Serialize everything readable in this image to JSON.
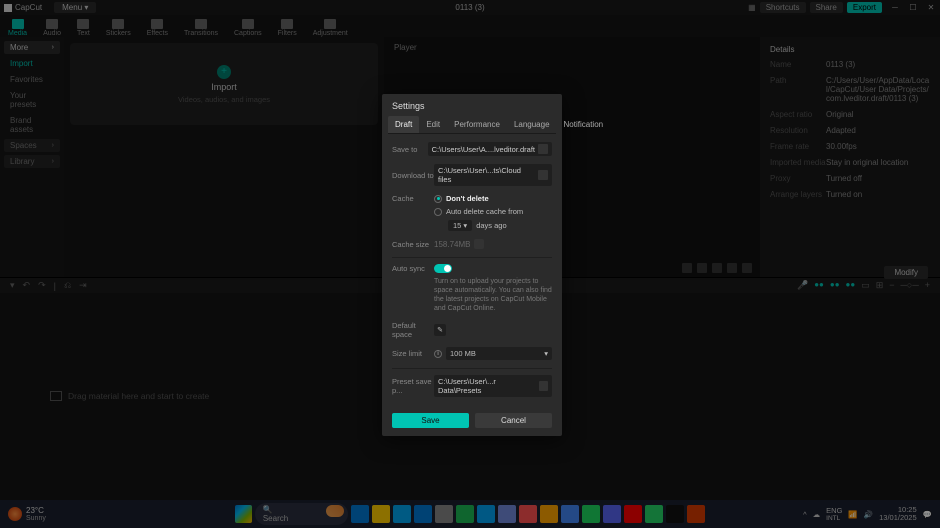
{
  "titlebar": {
    "app_name": "CapCut",
    "menu": "Menu",
    "project": "0113 (3)",
    "shortcuts": "Shortcuts",
    "share": "Share",
    "export": "Export"
  },
  "toolbar": {
    "tabs": [
      "Media",
      "Audio",
      "Text",
      "Stickers",
      "Effects",
      "Transitions",
      "Captions",
      "Filters",
      "Adjustment"
    ]
  },
  "sidebar": {
    "items": [
      {
        "label": "More",
        "type": "drop"
      },
      {
        "label": "Import",
        "type": "imp"
      },
      {
        "label": "Favorites",
        "type": "item"
      },
      {
        "label": "Your presets",
        "type": "item"
      },
      {
        "label": "Brand assets",
        "type": "item"
      },
      {
        "label": "Spaces",
        "type": "drop"
      },
      {
        "label": "Library",
        "type": "drop"
      }
    ]
  },
  "importbox": {
    "title": "Import",
    "subtitle": "Videos, audios, and images"
  },
  "player": {
    "title": "Player"
  },
  "details": {
    "header": "Details",
    "rows": [
      {
        "k": "Name",
        "v": "0113 (3)"
      },
      {
        "k": "Path",
        "v": "C:/Users/User/AppData/Local/CapCut/User Data/Projects/com.lveditor.draft/0113 (3)"
      },
      {
        "k": "Aspect ratio",
        "v": "Original"
      },
      {
        "k": "Resolution",
        "v": "Adapted"
      },
      {
        "k": "Frame rate",
        "v": "30.00fps"
      },
      {
        "k": "Imported media",
        "v": "Stay in original location"
      },
      {
        "k": "Proxy",
        "v": "Turned off"
      },
      {
        "k": "Arrange layers",
        "v": "Turned on"
      }
    ],
    "modify": "Modify"
  },
  "timeline": {
    "hint": "Drag material here and start to create"
  },
  "modal": {
    "title": "Settings",
    "tabs": [
      "Draft",
      "Edit",
      "Performance",
      "Language",
      "Notification"
    ],
    "save_to": {
      "label": "Save to",
      "path": "C:\\Users\\User\\A....lveditor.draft"
    },
    "download_to": {
      "label": "Download to",
      "path": "C:\\Users\\User\\...ts\\Cloud files"
    },
    "cache": {
      "label": "Cache",
      "dont_delete": "Don't delete",
      "auto_delete": "Auto delete cache from",
      "days_value": "15",
      "days_suffix": "days ago"
    },
    "cache_size": {
      "label": "Cache size",
      "value": "158.74MB"
    },
    "auto_sync": {
      "label": "Auto sync",
      "desc": "Turn on to upload your projects to space automatically. You can also find the latest projects on CapCut Mobile and CapCut Online."
    },
    "default_space": {
      "label": "Default space"
    },
    "size_limit": {
      "label": "Size limit",
      "value": "100 MB"
    },
    "preset": {
      "label": "Preset save p...",
      "path": "C:\\Users\\User\\...r Data\\Presets"
    },
    "save_btn": "Save",
    "cancel_btn": "Cancel"
  },
  "taskbar": {
    "temp": "23°C",
    "weather": "Sunny",
    "search": "Search",
    "lang1": "ENG",
    "lang2": "INTL",
    "time": "10:25",
    "date": "13/01/2025",
    "icons": [
      "#0078d4",
      "#ffcc00",
      "#00a4ef",
      "#0078d4",
      "#888",
      "#1db954",
      "#00a1f1",
      "#7289da",
      "#ff5050",
      "#ffa500",
      "#4285f4",
      "#1ed760",
      "#5865f2",
      "#ff0000",
      "#25d366",
      "#111111",
      "#d83b01"
    ]
  }
}
